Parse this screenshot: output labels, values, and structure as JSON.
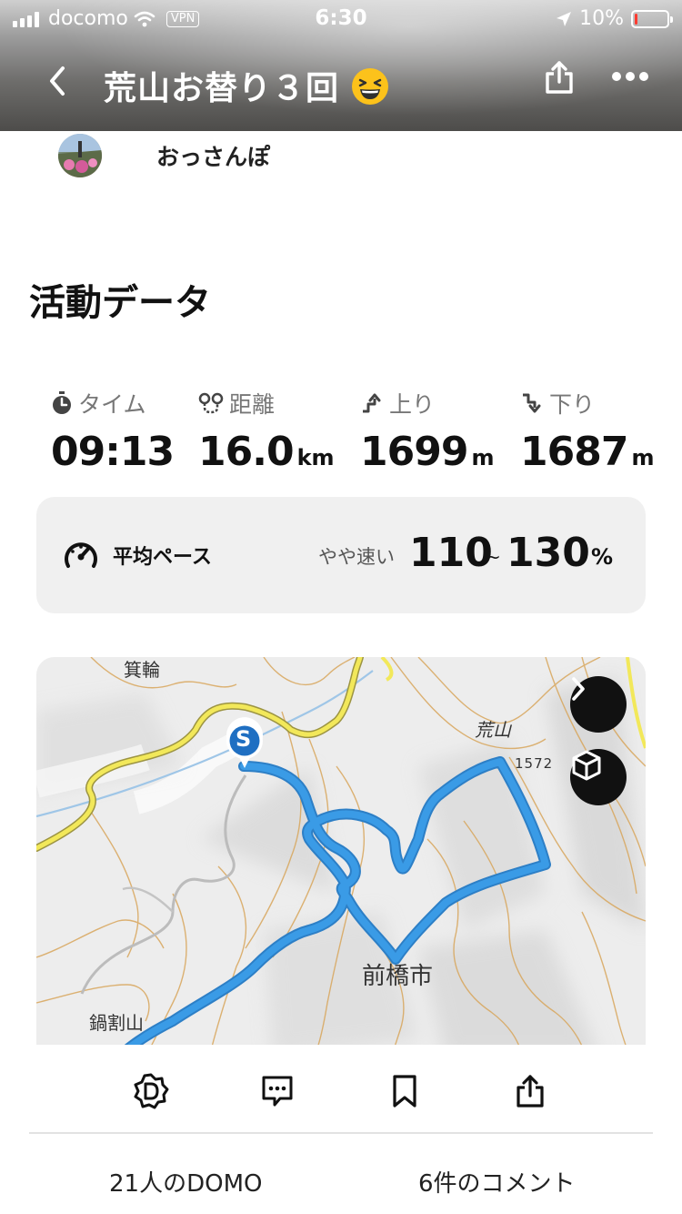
{
  "status_bar": {
    "carrier": "docomo",
    "vpn": "VPN",
    "time": "6:30",
    "battery": "10%",
    "battery_level": 0.1
  },
  "header": {
    "title": "荒山お替り３回",
    "emoji_icon": "grinning-squinting-face-icon",
    "back_icon": "chevron-left-icon",
    "share_icon": "share-icon",
    "more_icon": "ellipsis-icon"
  },
  "author": {
    "name": "おっさんぽ"
  },
  "activity": {
    "section_title": "活動データ",
    "stats": {
      "time": {
        "label": "タイム",
        "value": "09:13",
        "unit": "",
        "icon": "stopwatch-icon"
      },
      "distance": {
        "label": "距離",
        "value": "16.0",
        "unit": "km",
        "icon": "route-pin-icon"
      },
      "ascent": {
        "label": "上り",
        "value": "1699",
        "unit": "m",
        "icon": "ascent-arrow-icon"
      },
      "descent": {
        "label": "下り",
        "value": "1687",
        "unit": "m",
        "icon": "descent-arrow-icon"
      }
    },
    "pace": {
      "label": "平均ペース",
      "description": "やや速い",
      "min": "110",
      "separator": "~",
      "max": "130",
      "unit": "%",
      "icon": "speedometer-icon"
    }
  },
  "map": {
    "labels": {
      "minowa": "箕輪",
      "arayama": "荒山",
      "elevation": "1572",
      "maebashi": "前橋市",
      "nabewariyama": "鍋割山"
    },
    "start_marker": "S",
    "route_color": "#3a9be6",
    "road_color": "#f2e85a",
    "expand_icon": "chevron-right-icon",
    "view_3d_icon": "cube-icon"
  },
  "bottom_bar": {
    "domo_icon": "domo-icon",
    "comment_icon": "comment-icon",
    "bookmark_icon": "bookmark-icon",
    "share_icon": "share-icon",
    "domo_count": "21人のDOMO",
    "comment_count": "6件のコメント"
  }
}
